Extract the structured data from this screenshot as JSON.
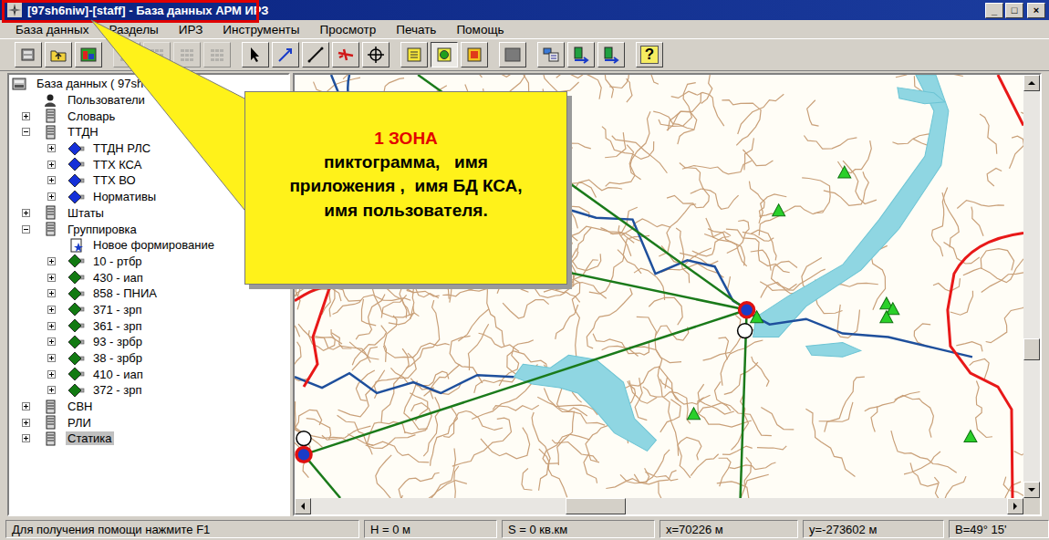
{
  "window": {
    "title": "[97sh6niw]-[staff] - База данных АРМ ИРЗ",
    "buttons": [
      "_",
      "□",
      "×"
    ]
  },
  "menu": [
    "База данных",
    "Разделы",
    "ИРЗ",
    "Инструменты",
    "Просмотр",
    "Печать",
    "Помощь"
  ],
  "toolbar": [
    {
      "kind": "database",
      "group": 0,
      "disabled": false,
      "pressed": false,
      "label": ""
    },
    {
      "kind": "folder-up",
      "group": 0,
      "disabled": false,
      "pressed": false,
      "label": ""
    },
    {
      "kind": "chart",
      "group": 0,
      "disabled": false,
      "pressed": false,
      "label": ""
    },
    {
      "kind": "grid",
      "group": 1,
      "disabled": true,
      "pressed": false,
      "label": ""
    },
    {
      "kind": "grid",
      "group": 1,
      "disabled": true,
      "pressed": false,
      "label": ""
    },
    {
      "kind": "grid",
      "group": 1,
      "disabled": true,
      "pressed": false,
      "label": ""
    },
    {
      "kind": "grid",
      "group": 1,
      "disabled": true,
      "pressed": false,
      "label": ""
    },
    {
      "kind": "arrow",
      "group": 2,
      "disabled": false,
      "pressed": false,
      "label": ""
    },
    {
      "kind": "line-blue",
      "group": 2,
      "disabled": false,
      "pressed": false,
      "label": ""
    },
    {
      "kind": "line",
      "group": 2,
      "disabled": false,
      "pressed": false,
      "label": ""
    },
    {
      "kind": "plane",
      "group": 2,
      "disabled": false,
      "pressed": false,
      "label": ""
    },
    {
      "kind": "crosshair",
      "group": 2,
      "disabled": false,
      "pressed": false,
      "label": ""
    },
    {
      "kind": "doc-yellow",
      "group": 3,
      "disabled": false,
      "pressed": false,
      "label": ""
    },
    {
      "kind": "doc-green",
      "group": 3,
      "disabled": false,
      "pressed": true,
      "label": ""
    },
    {
      "kind": "doc-red",
      "group": 3,
      "disabled": false,
      "pressed": false,
      "label": ""
    },
    {
      "kind": "square",
      "group": 4,
      "disabled": false,
      "pressed": false,
      "label": ""
    },
    {
      "kind": "layers",
      "group": 5,
      "disabled": false,
      "pressed": false,
      "label": ""
    },
    {
      "kind": "export",
      "group": 5,
      "disabled": false,
      "pressed": false,
      "label": ""
    },
    {
      "kind": "export",
      "group": 5,
      "disabled": false,
      "pressed": false,
      "label": ""
    },
    {
      "kind": "help",
      "group": 6,
      "disabled": false,
      "pressed": false,
      "label": "?"
    }
  ],
  "tree": [
    {
      "label": "База данных ( 97sh6niw )",
      "level": 0,
      "kind": "database",
      "has_children": false,
      "expanded": true,
      "selected": false
    },
    {
      "label": "Пользователи",
      "level": 1,
      "kind": "user",
      "has_children": false,
      "expanded": false,
      "selected": false
    },
    {
      "label": "Словарь",
      "level": 1,
      "kind": "server",
      "has_children": true,
      "expanded": false,
      "selected": false
    },
    {
      "label": "ТТДН",
      "level": 1,
      "kind": "server",
      "has_children": true,
      "expanded": true,
      "selected": false
    },
    {
      "label": "ТТДН РЛС",
      "level": 2,
      "kind": "diamond",
      "color": "#1530d8",
      "has_children": true,
      "expanded": false,
      "selected": false
    },
    {
      "label": "ТТХ КСА",
      "level": 2,
      "kind": "diamond",
      "color": "#1530d8",
      "has_children": true,
      "expanded": false,
      "selected": false
    },
    {
      "label": "ТТХ ВО",
      "level": 2,
      "kind": "diamond",
      "color": "#1530d8",
      "has_children": true,
      "expanded": false,
      "selected": false
    },
    {
      "label": "Нормативы",
      "level": 2,
      "kind": "diamond",
      "color": "#1530d8",
      "has_children": true,
      "expanded": false,
      "selected": false
    },
    {
      "label": "Штаты",
      "level": 1,
      "kind": "server",
      "has_children": true,
      "expanded": false,
      "selected": false
    },
    {
      "label": "Группировка",
      "level": 1,
      "kind": "server",
      "has_children": true,
      "expanded": true,
      "selected": false
    },
    {
      "label": "Новое формирование",
      "level": 2,
      "kind": "document",
      "has_children": false,
      "expanded": false,
      "selected": false
    },
    {
      "label": "10 - ртбр",
      "level": 2,
      "kind": "diamond",
      "color": "#127a12",
      "has_children": true,
      "expanded": false,
      "selected": false
    },
    {
      "label": "430 - иап",
      "level": 2,
      "kind": "diamond",
      "color": "#127a12",
      "has_children": true,
      "expanded": false,
      "selected": false
    },
    {
      "label": "858 - ПНИА",
      "level": 2,
      "kind": "diamond",
      "color": "#127a12",
      "has_children": true,
      "expanded": false,
      "selected": false
    },
    {
      "label": "371 - зрп",
      "level": 2,
      "kind": "diamond",
      "color": "#127a12",
      "has_children": true,
      "expanded": false,
      "selected": false
    },
    {
      "label": "361 - зрп",
      "level": 2,
      "kind": "diamond",
      "color": "#127a12",
      "has_children": true,
      "expanded": false,
      "selected": false
    },
    {
      "label": "93 - зрбр",
      "level": 2,
      "kind": "diamond",
      "color": "#127a12",
      "has_children": true,
      "expanded": false,
      "selected": false
    },
    {
      "label": "38 - зрбр",
      "level": 2,
      "kind": "diamond",
      "color": "#127a12",
      "has_children": true,
      "expanded": false,
      "selected": false
    },
    {
      "label": "410 - иап",
      "level": 2,
      "kind": "diamond",
      "color": "#127a12",
      "has_children": true,
      "expanded": false,
      "selected": false
    },
    {
      "label": "372 - зрп",
      "level": 2,
      "kind": "diamond",
      "color": "#127a12",
      "has_children": true,
      "expanded": false,
      "selected": false
    },
    {
      "label": "СВН",
      "level": 1,
      "kind": "server",
      "has_children": true,
      "expanded": false,
      "selected": false
    },
    {
      "label": "РЛИ",
      "level": 1,
      "kind": "server",
      "has_children": true,
      "expanded": false,
      "selected": false
    },
    {
      "label": "Статика",
      "level": 1,
      "kind": "server",
      "has_children": true,
      "expanded": false,
      "selected": true
    }
  ],
  "map": {
    "vscroll_level": 0.67,
    "hscroll_level": 0.4
  },
  "callout": {
    "title": "1 ЗОНА",
    "lines": [
      "пиктограмма,   имя",
      "приложения ,  имя БД КСА,",
      "имя пользователя."
    ]
  },
  "status_bar": [
    "Для получения помощи нажмите F1",
    "H = 0 м",
    "S = 0 кв.км",
    "x=70226 м",
    "y=-273602 м",
    "B=49° 15'"
  ]
}
